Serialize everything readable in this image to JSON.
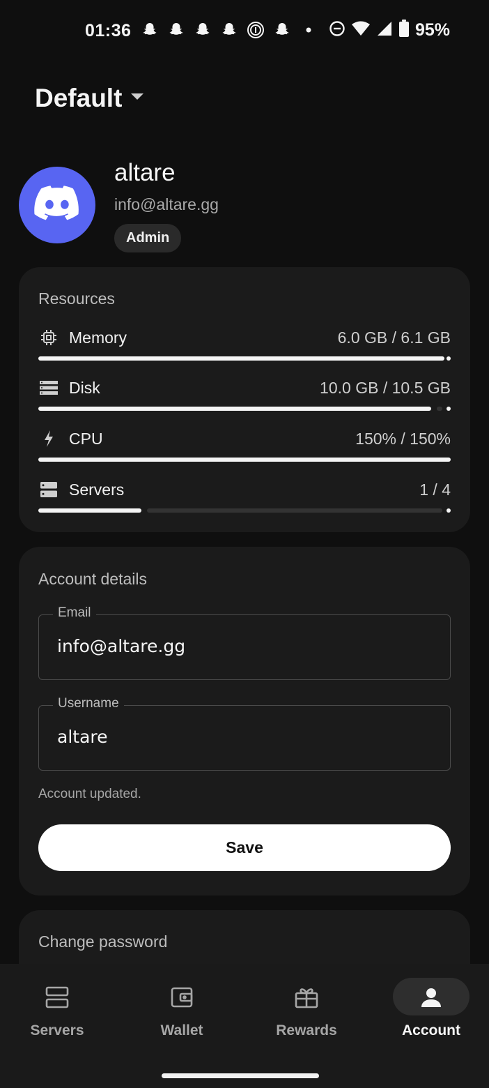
{
  "status_bar": {
    "time": "01:36",
    "notification_icons": [
      "snapchat-icon",
      "snapchat-icon",
      "snapchat-icon",
      "snapchat-icon",
      "fingerprint-icon",
      "snapchat-icon",
      "more-dot-icon"
    ],
    "dnd_icon": "do-not-disturb-icon",
    "wifi_icon": "wifi-icon",
    "signal_icon": "signal-icon",
    "battery_icon": "battery-icon",
    "battery": "95%"
  },
  "header": {
    "workspace": "Default",
    "dropdown_icon": "caret-down-icon"
  },
  "profile": {
    "avatar_icon": "discord-icon",
    "avatar_color": "#5865f2",
    "name": "altare",
    "email": "info@altare.gg",
    "role": "Admin"
  },
  "resources": {
    "title": "Resources",
    "items": [
      {
        "icon": "memory-chip-icon",
        "label": "Memory",
        "value": "6.0 GB / 6.1 GB",
        "fraction": 0.984
      },
      {
        "icon": "disk-icon",
        "label": "Disk",
        "value": "10.0 GB / 10.5 GB",
        "fraction": 0.952
      },
      {
        "icon": "lightning-icon",
        "label": "CPU",
        "value": "150% / 150%",
        "fraction": 1.0
      },
      {
        "icon": "servers-icon",
        "label": "Servers",
        "value": "1 / 4",
        "fraction": 0.25
      }
    ]
  },
  "account_details": {
    "title": "Account details",
    "email_label": "Email",
    "email_value": "info@altare.gg",
    "username_label": "Username",
    "username_value": "altare",
    "status": "Account updated.",
    "save_label": "Save"
  },
  "change_password": {
    "title": "Change password"
  },
  "bottom_nav": {
    "items": [
      {
        "label": "Servers",
        "icon": "servers-icon",
        "active": false
      },
      {
        "label": "Wallet",
        "icon": "wallet-icon",
        "active": false
      },
      {
        "label": "Rewards",
        "icon": "gift-icon",
        "active": false
      },
      {
        "label": "Account",
        "icon": "person-icon",
        "active": true
      }
    ]
  },
  "colors": {
    "background": "#0f0f0f",
    "card": "#1b1b1b",
    "accent": "#ffffff",
    "discord": "#5865f2"
  }
}
